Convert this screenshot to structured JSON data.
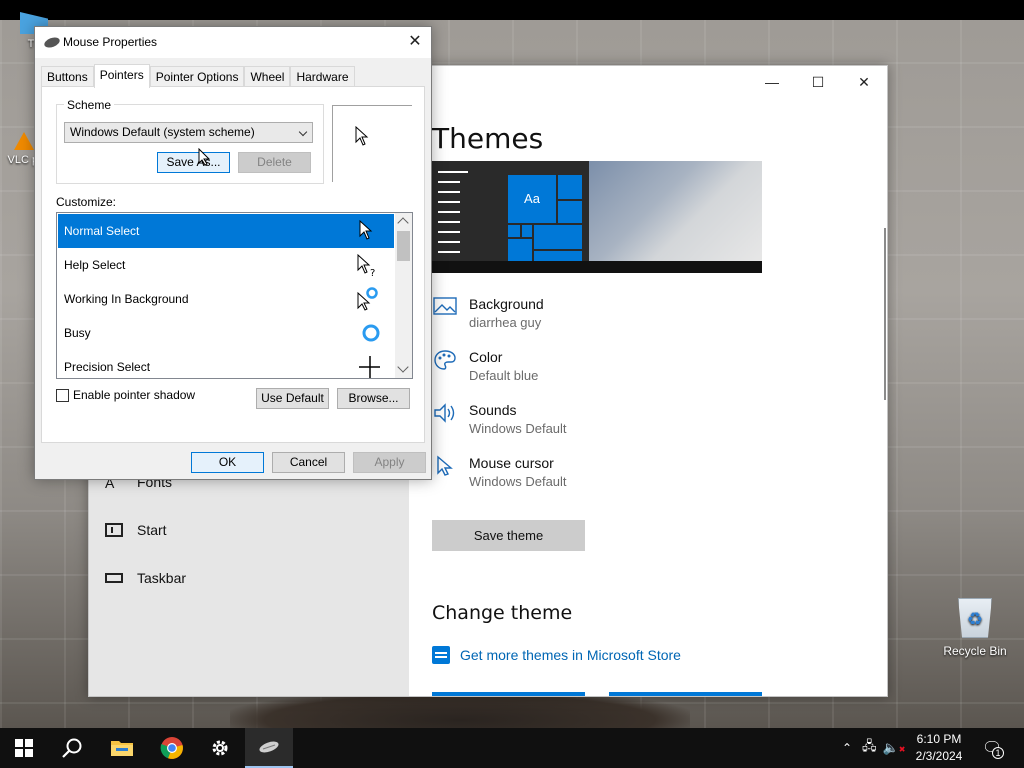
{
  "desktop": {
    "icons": [
      {
        "label": "Th"
      },
      {
        "label": "VLC pl"
      },
      {
        "label": "Recycle Bin"
      }
    ]
  },
  "settings": {
    "window_controls": [
      "—",
      "☐",
      "✕"
    ],
    "sidebar": [
      {
        "label": "Fonts",
        "icon": "fonts-icon"
      },
      {
        "label": "Start",
        "icon": "start-icon"
      },
      {
        "label": "Taskbar",
        "icon": "taskbar-icon"
      }
    ],
    "title": "Themes",
    "preview_tile_text": "Aa",
    "rows": [
      {
        "title": "Background",
        "value": "diarrhea guy",
        "icon": "picture-icon"
      },
      {
        "title": "Color",
        "value": "Default blue",
        "icon": "palette-icon"
      },
      {
        "title": "Sounds",
        "value": "Windows Default",
        "icon": "speaker-icon"
      },
      {
        "title": "Mouse cursor",
        "value": "Windows Default",
        "icon": "cursor-icon"
      }
    ],
    "save_theme": "Save theme",
    "change_theme": "Change theme",
    "store_link": "Get more themes in Microsoft Store",
    "accent": "#0078d7"
  },
  "dialog": {
    "title": "Mouse Properties",
    "close": "✕",
    "tabs": [
      "Buttons",
      "Pointers",
      "Pointer Options",
      "Wheel",
      "Hardware"
    ],
    "active_tab": "Pointers",
    "scheme_label": "Scheme",
    "scheme_value": "Windows Default (system scheme)",
    "save_as": "Save As...",
    "delete": "Delete",
    "customize_label": "Customize:",
    "pointers": [
      {
        "label": "Normal Select",
        "cursor": "arrow-cursor-icon",
        "selected": true
      },
      {
        "label": "Help Select",
        "cursor": "help-cursor-icon",
        "selected": false
      },
      {
        "label": "Working In Background",
        "cursor": "working-cursor-icon",
        "selected": false
      },
      {
        "label": "Busy",
        "cursor": "busy-cursor-icon",
        "selected": false
      },
      {
        "label": "Precision Select",
        "cursor": "crosshair-cursor-icon",
        "selected": false
      }
    ],
    "shadow_label": "Enable pointer shadow",
    "shadow_checked": false,
    "use_default": "Use Default",
    "browse": "Browse...",
    "ok": "OK",
    "cancel": "Cancel",
    "apply": "Apply"
  },
  "taskbar": {
    "apps": [
      "start-icon",
      "search-icon",
      "file-explorer-icon",
      "chrome-icon",
      "settings-icon",
      "mouse-icon"
    ],
    "time": "6:10 PM",
    "date": "2/3/2024",
    "notification_count": "1"
  }
}
